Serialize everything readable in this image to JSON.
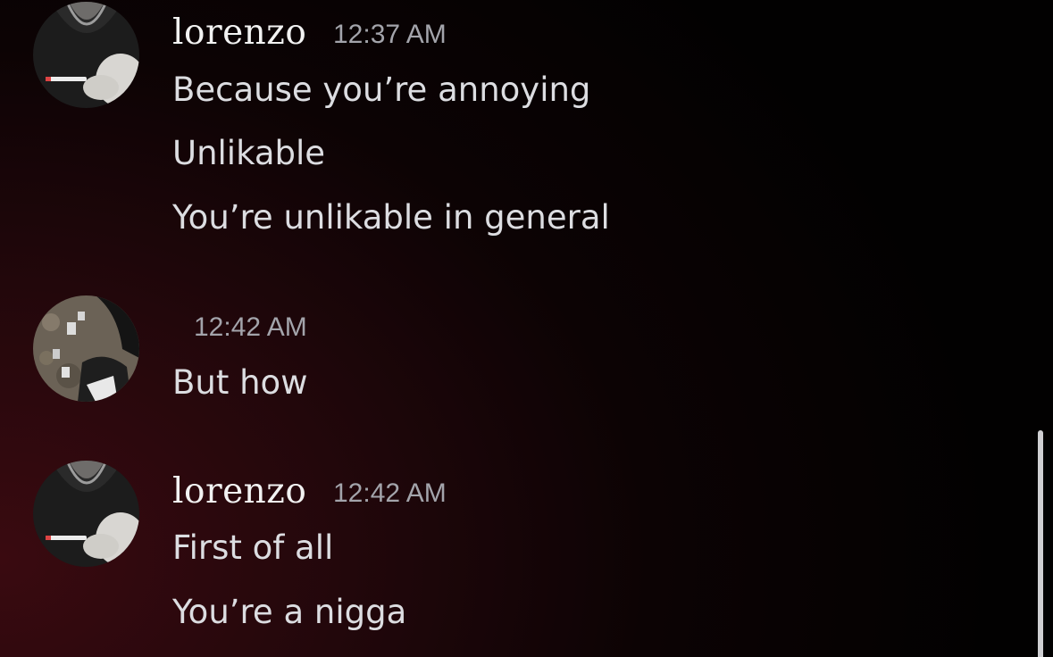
{
  "messages": [
    {
      "author": "lorenzo",
      "time": "12:37 AM",
      "lines": [
        "Because you’re annoying",
        "Unlikable",
        "You’re unlikable in general"
      ]
    },
    {
      "author": "",
      "time": "12:42 AM",
      "lines": [
        "But how"
      ]
    },
    {
      "author": "lorenzo",
      "time": "12:42 AM",
      "lines": [
        "First of all",
        "You’re a nigga"
      ]
    }
  ],
  "colors": {
    "text": "#dcdde1",
    "username": "#f2f2f2",
    "timestamp": "#a3a4ab",
    "background_accent": "#3a0a10"
  }
}
